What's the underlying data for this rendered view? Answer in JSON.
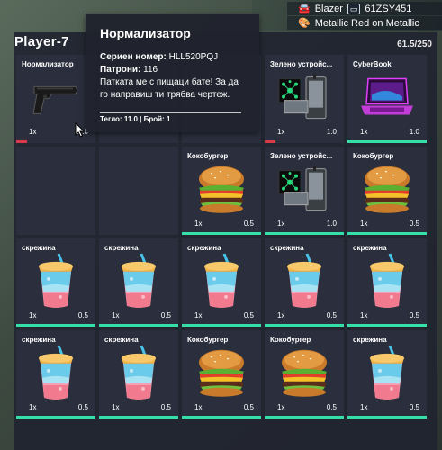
{
  "hud": {
    "vehicle1_name": "Blazer",
    "vehicle1_plate": "61ZSY451",
    "vehicle2_name": "Metallic Red on Metallic"
  },
  "inventory": {
    "title": "Player-7",
    "weight": "61.5/250",
    "slots": [
      {
        "name": "Нормализатор",
        "qty": "1x",
        "weight": "11.0",
        "item": "pistol"
      },
      {
        "name": "",
        "qty": "",
        "weight": "",
        "item": ""
      },
      {
        "name": "",
        "qty": "",
        "weight": "",
        "item": ""
      },
      {
        "name": "Зелено устройс...",
        "qty": "1x",
        "weight": "1.0",
        "item": "device"
      },
      {
        "name": "CyberBook",
        "qty": "1x",
        "weight": "1.0",
        "item": "laptop"
      },
      {
        "name": "",
        "qty": "",
        "weight": "",
        "item": ""
      },
      {
        "name": "",
        "qty": "",
        "weight": "",
        "item": ""
      },
      {
        "name": "Кокобургер",
        "qty": "1x",
        "weight": "0.5",
        "item": "burger"
      },
      {
        "name": "Зелено устройс...",
        "qty": "1x",
        "weight": "1.0",
        "item": "device"
      },
      {
        "name": "Кокобургер",
        "qty": "1x",
        "weight": "0.5",
        "item": "burger"
      },
      {
        "name": "скрежина",
        "qty": "1x",
        "weight": "0.5",
        "item": "drink"
      },
      {
        "name": "скрежина",
        "qty": "1x",
        "weight": "0.5",
        "item": "drink"
      },
      {
        "name": "скрежина",
        "qty": "1x",
        "weight": "0.5",
        "item": "drink"
      },
      {
        "name": "скрежина",
        "qty": "1x",
        "weight": "0.5",
        "item": "drink"
      },
      {
        "name": "скрежина",
        "qty": "1x",
        "weight": "0.5",
        "item": "drink"
      },
      {
        "name": "скрежина",
        "qty": "1x",
        "weight": "0.5",
        "item": "drink"
      },
      {
        "name": "скрежина",
        "qty": "1x",
        "weight": "0.5",
        "item": "drink"
      },
      {
        "name": "Кокобургер",
        "qty": "1x",
        "weight": "0.5",
        "item": "burger"
      },
      {
        "name": "Кокобургер",
        "qty": "1x",
        "weight": "0.5",
        "item": "burger"
      },
      {
        "name": "скрежина",
        "qty": "1x",
        "weight": "0.5",
        "item": "drink"
      }
    ]
  },
  "tooltip": {
    "title": "Нормализатор",
    "serial_label": "Сериен номер:",
    "serial_value": "HLL520PQJ",
    "ammo_label": "Патрони:",
    "ammo_value": "116",
    "description": "Патката ме с пищаци бате! За да го направиш ти трябва чертеж.",
    "footer": "Тегло: 11.0 | Брой: 1"
  },
  "colors": {
    "durability_full": "#34e0a8",
    "durability_low": "#d83a4a"
  }
}
